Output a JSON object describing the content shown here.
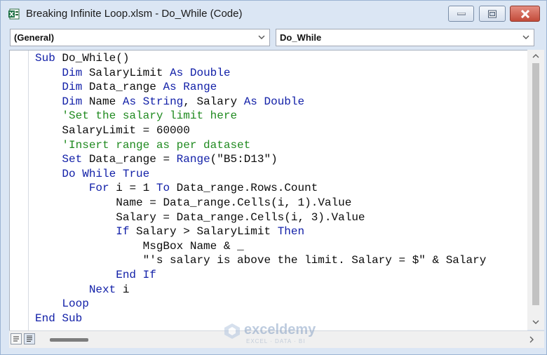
{
  "window": {
    "title": "Breaking Infinite Loop.xlsm - Do_While (Code)",
    "controls": [
      "minimize",
      "maximize",
      "close"
    ]
  },
  "object_dropdown": {
    "value": "(General)"
  },
  "procedure_dropdown": {
    "value": "Do_While"
  },
  "code_lines": [
    "Sub Do_While()",
    "    Dim SalaryLimit As Double",
    "    Dim Data_range As Range",
    "    Dim Name As String, Salary As Double",
    "    'Set the salary limit here",
    "    SalaryLimit = 60000",
    "    'Insert range as per dataset",
    "    Set Data_range = Range(\"B5:D13\")",
    "    Do While True",
    "        For i = 1 To Data_range.Rows.Count",
    "            Name = Data_range.Cells(i, 1).Value",
    "            Salary = Data_range.Cells(i, 3).Value",
    "            If Salary > SalaryLimit Then",
    "                MsgBox Name & _",
    "                \"'s salary is above the limit. Salary = $\" & Salary",
    "            End If",
    "        Next i",
    "    Loop",
    "End Sub"
  ],
  "watermark": {
    "name": "exceldemy",
    "tagline": "EXCEL · DATA · BI"
  },
  "colors": {
    "keyword": "#1220a8",
    "comment": "#1f8a1f",
    "text": "#0b0b0b",
    "close_button": "#c34b3a"
  },
  "icons": [
    "excel-vba-icon",
    "minimize-icon",
    "maximize-icon",
    "close-icon",
    "chevron-down-icon",
    "scroll-up-icon",
    "scroll-down-icon",
    "scroll-right-icon",
    "procedure-view-icon",
    "full-module-view-icon",
    "exceldemy-logo-icon"
  ]
}
